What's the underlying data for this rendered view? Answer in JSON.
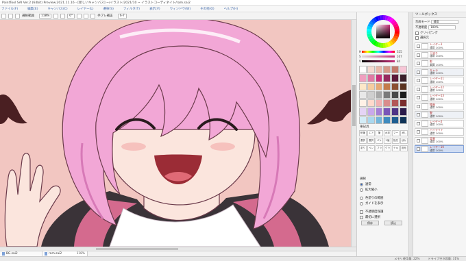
{
  "window": {
    "title": "PaintTool SAI Ver.2 (64bit) Preview.2021.11.16 - [新しいキャンバス] ~/イラスト/2021/10 ~ イラストコーディネイト/ram.sai2"
  },
  "menu": {
    "items": [
      "ファイル(F)",
      "編集(E)",
      "キャンバス(C)",
      "レイヤー(L)",
      "選択(S)",
      "フィルタ(T)",
      "表示(V)",
      "ウィンドウ(W)",
      "その他(O)",
      "ヘルプ(H)"
    ]
  },
  "toolbar": {
    "selection_label": "選択範囲",
    "zoom_value": "118%",
    "rotation_value": "0°",
    "stabilizer_label": "手ブレ補正",
    "stabilizer_value": "S-7"
  },
  "colors": {
    "canvas_bg": "#f2c6c1",
    "hair": "#f2a7d6",
    "hair_shadow": "#d779b7",
    "skin": "#fbe5dd",
    "wing": "#4a1f22",
    "hood": "#3a3338",
    "hood_lining": "#d46a8e",
    "mouth": "#9b2c36"
  },
  "color_panel": {
    "current_color": "#c8307a",
    "sliders": [
      {
        "label": "H",
        "value": "325"
      },
      {
        "label": "S",
        "value": "167"
      },
      {
        "label": "V",
        "value": "84"
      }
    ],
    "swatches": [
      "#ffffff",
      "#f4d9d0",
      "#e9b8aa",
      "#d79a8a",
      "#c3796a",
      "#f7c6d6",
      "#ef9fbf",
      "#e07aa4",
      "#c8307a",
      "#962a5e",
      "#5c1a3a",
      "#3a1f2a",
      "#fde8c8",
      "#f6cda0",
      "#e6a975",
      "#c47b4b",
      "#8b5032",
      "#5b3320",
      "#e8e8e8",
      "#cfcfcf",
      "#a8a8a8",
      "#7a7a7a",
      "#4a4a4a",
      "#1c1c1c",
      "#fff1e6",
      "#ffd9cc",
      "#f2b3b3",
      "#d98c8c",
      "#b35959",
      "#7a2e2e",
      "#e5d4f5",
      "#c9a8eb",
      "#a47fd6",
      "#7a55b8",
      "#4f3586",
      "#2a1b4a",
      "#d3ecf7",
      "#a9d7ee",
      "#73b5da",
      "#3f8bbf",
      "#1f5e91",
      "#0f3357"
    ],
    "tools_title": "筆記具",
    "brushes": [
      "鉛筆",
      "エアブラシ",
      "筆",
      "水彩筆",
      "マーカー",
      "消しゴム",
      "選択ペン",
      "選択消し",
      "バケツ",
      "2値ペン",
      "指先",
      "ぼかし",
      "塗り",
      "ペン",
      "ブラシ",
      "グラデ",
      "テキスト",
      "図形"
    ],
    "mode_title": "選択",
    "mode_options": [
      {
        "label": "通常",
        "selected": true
      },
      {
        "label": "拡大縮小",
        "selected": false
      }
    ],
    "options": [
      "色塗りの範囲",
      "ガイドを表示"
    ],
    "check_labels": [
      "不透明度保護",
      "最初に選択"
    ],
    "buttons": [
      "保存",
      "読込"
    ]
  },
  "layer_panel": {
    "title": "ツールボックス",
    "blend_label": "合成モード",
    "blend_value": "通常",
    "opacity_label": "不透明度",
    "opacity_value": "100%",
    "options": [
      "クリッピング",
      "選択元"
    ],
    "layers": [
      {
        "name": "レイヤー1",
        "sub": "通常 100%",
        "folder": false,
        "selected": false
      },
      {
        "name": "下塗り",
        "sub": "通常 100%",
        "folder": false,
        "selected": false
      },
      {
        "name": "影",
        "sub": "乗算 100%",
        "folder": false,
        "selected": false
      },
      {
        "name": "キャラ",
        "sub": "通常 100%",
        "folder": true,
        "selected": false
      },
      {
        "name": "レイヤー11",
        "sub": "通常 100%",
        "folder": false,
        "selected": false
      },
      {
        "name": "レイヤー12",
        "sub": "通常 100%",
        "folder": false,
        "selected": false
      },
      {
        "name": "レイヤー13",
        "sub": "通常 100%",
        "folder": false,
        "selected": false
      },
      {
        "name": "線画",
        "sub": "通常 100%",
        "folder": false,
        "selected": false
      },
      {
        "name": "髪",
        "sub": "通常 100%",
        "folder": true,
        "selected": false
      },
      {
        "name": "レイヤー2",
        "sub": "通常 100%",
        "folder": false,
        "selected": false
      },
      {
        "name": "ハイライト",
        "sub": "通常 100%",
        "folder": false,
        "selected": false
      },
      {
        "name": "背景",
        "sub": "通常 100%",
        "folder": false,
        "selected": false
      },
      {
        "name": "レイヤー10",
        "sub": "通常 100%",
        "folder": false,
        "selected": true
      }
    ]
  },
  "documents": [
    {
      "name": "BG.sai2",
      "zoom": "",
      "active": false
    },
    {
      "name": "ram.sai2",
      "zoom": "118%",
      "active": true
    }
  ],
  "status": {
    "memory": "メモリ使用量: 22%",
    "drive": "ドライブ空き容量: 31%"
  }
}
